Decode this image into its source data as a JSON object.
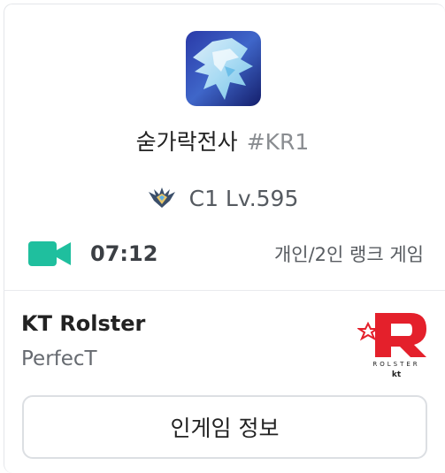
{
  "summoner": {
    "name": "숟가락전사",
    "tag": "#KR1"
  },
  "rank": {
    "icon": "challenger-emblem-icon",
    "text": "C1 Lv.595"
  },
  "game": {
    "status_icon": "video-camera-icon",
    "duration": "07:12",
    "queue": "개인/2인 랭크 게임"
  },
  "team": {
    "name": "KT Rolster",
    "player": "PerfecT",
    "logo_text": "ROLSTER",
    "logo_sub": "kt"
  },
  "button": {
    "label": "인게임 정보"
  },
  "colors": {
    "live": "#1fbf9e",
    "logo_red": "#e4202b"
  }
}
